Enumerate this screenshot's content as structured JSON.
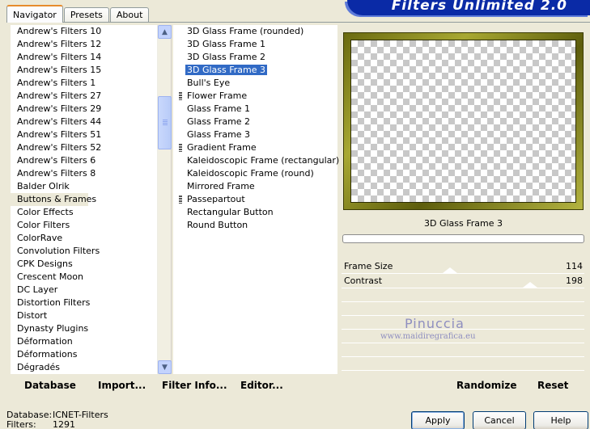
{
  "app": {
    "banner_title": "Filters Unlimited 2.0"
  },
  "tabs": [
    {
      "label": "Navigator",
      "active": true
    },
    {
      "label": "Presets",
      "active": false
    },
    {
      "label": "About",
      "active": false
    }
  ],
  "categories": [
    "Andrew's Filters 10",
    "Andrew's Filters 12",
    "Andrew's Filters 14",
    "Andrew's Filters 15",
    "Andrew's Filters 1",
    "Andrew's Filters 27",
    "Andrew's Filters 29",
    "Andrew's Filters 44",
    "Andrew's Filters 51",
    "Andrew's Filters 52",
    "Andrew's Filters 6",
    "Andrew's Filters 8",
    "Balder Olrik",
    "Buttons & Frames",
    "Color Effects",
    "Color Filters",
    "ColorRave",
    "Convolution Filters",
    "CPK Designs",
    "Crescent Moon",
    "DC Layer",
    "Distortion Filters",
    "Distort",
    "Dynasty Plugins",
    "Déformation",
    "Déformations",
    "Dégradés"
  ],
  "selected_category": "Buttons & Frames",
  "filters": [
    {
      "label": "3D Glass Frame (rounded)",
      "marked": false
    },
    {
      "label": "3D Glass Frame 1",
      "marked": false
    },
    {
      "label": "3D Glass Frame 2",
      "marked": false
    },
    {
      "label": "3D Glass Frame 3",
      "marked": false
    },
    {
      "label": "Bull's Eye",
      "marked": false
    },
    {
      "label": "Flower Frame",
      "marked": true
    },
    {
      "label": "Glass Frame 1",
      "marked": false
    },
    {
      "label": "Glass Frame 2",
      "marked": false
    },
    {
      "label": "Glass Frame 3",
      "marked": false
    },
    {
      "label": "Gradient Frame",
      "marked": true
    },
    {
      "label": "Kaleidoscopic Frame (rectangular)",
      "marked": false
    },
    {
      "label": "Kaleidoscopic Frame (round)",
      "marked": false
    },
    {
      "label": "Mirrored Frame",
      "marked": false
    },
    {
      "label": "Passepartout",
      "marked": true
    },
    {
      "label": "Rectangular Button",
      "marked": false
    },
    {
      "label": "Round Button",
      "marked": false
    }
  ],
  "selected_filter": "3D Glass Frame 3",
  "preview": {
    "filter_name": "3D Glass Frame 3",
    "frame_color": "#8a8a1c"
  },
  "params": [
    {
      "name": "Frame Size",
      "value": "114",
      "level": 0.447
    },
    {
      "name": "Contrast",
      "value": "198",
      "level": 0.776
    }
  ],
  "watermark": {
    "name": "Pinuccia",
    "url": "www.maidiregrafica.eu"
  },
  "toolbar": {
    "database": "Database",
    "import": "Import...",
    "filter_info": "Filter Info...",
    "editor": "Editor...",
    "randomize": "Randomize",
    "reset": "Reset"
  },
  "status": {
    "database_label": "Database:",
    "database_value": "ICNET-Filters",
    "filters_label": "Filters:",
    "filters_value": "1291"
  },
  "buttons": {
    "apply": "Apply",
    "cancel": "Cancel",
    "help": "Help"
  }
}
